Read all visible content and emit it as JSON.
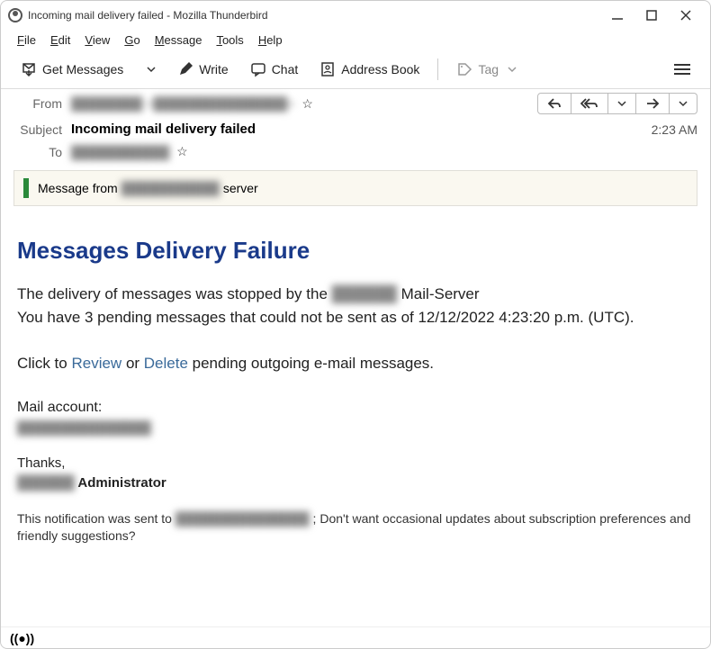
{
  "window": {
    "title": "Incoming mail delivery failed - Mozilla Thunderbird"
  },
  "menu": {
    "file": "File",
    "edit": "Edit",
    "view": "View",
    "go": "Go",
    "message": "Message",
    "tools": "Tools",
    "help": "Help"
  },
  "toolbar": {
    "get_messages": "Get Messages",
    "write": "Write",
    "chat": "Chat",
    "address_book": "Address Book",
    "tag": "Tag"
  },
  "header": {
    "from_label": "From",
    "from_value": "████████  <███████████████>",
    "subject_label": "Subject",
    "subject_value": "Incoming mail delivery failed",
    "to_label": "To",
    "to_value": "███████████",
    "time": "2:23 AM"
  },
  "banner": {
    "prefix": "Message from ",
    "server_name": "███████████",
    "suffix": " server"
  },
  "body": {
    "title": "Messages Delivery Failure",
    "line1a": "The delivery of messages was stopped by the ",
    "line1_domain": "██████",
    "line1b": " Mail-Server",
    "line2": "You have 3 pending messages that could not be sent as of 12/12/2022 4:23:20 p.m. (UTC).",
    "click_to": "Click to  ",
    "review": "Review",
    "or": "  or  ",
    "delete": "Delete",
    "pending": "  pending outgoing e-mail messages.",
    "mail_account_label": "Mail account:",
    "mail_account_value": "███████████████",
    "thanks": "Thanks,",
    "admin_domain": "██████",
    "admin_suffix": " Administrator",
    "footer_a": "This notification was sent to ",
    "footer_email": "███████████████",
    "footer_b": " ; Don't want occasional updates about subscription preferences and friendly suggestions?"
  }
}
